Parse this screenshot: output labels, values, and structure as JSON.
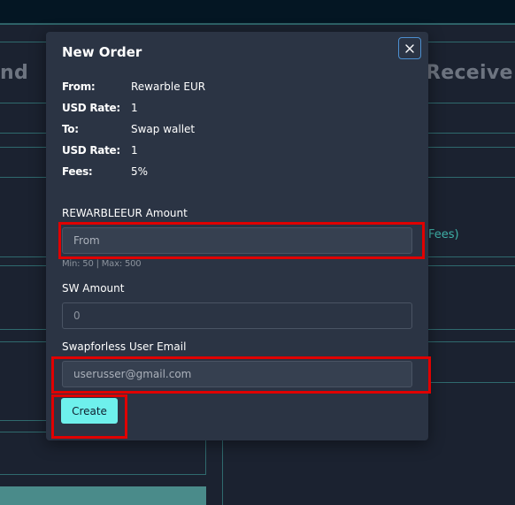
{
  "background": {
    "heading_left": "nd",
    "heading_right": "Receive",
    "fees_fragment": "Fees)"
  },
  "modal": {
    "title": "New Order",
    "close_icon": "close-icon",
    "info": [
      {
        "label": "From:",
        "value": "Rewarble EUR"
      },
      {
        "label": "USD Rate:",
        "value": "1"
      },
      {
        "label": "To:",
        "value": "Swap wallet"
      },
      {
        "label": "USD Rate:",
        "value": "1"
      },
      {
        "label": "Fees:",
        "value": "5%"
      }
    ],
    "amount_from": {
      "label": "REWARBLEEUR Amount",
      "placeholder": "From",
      "value": "",
      "hint": "Min: 50 | Max: 500"
    },
    "amount_to": {
      "label": "SW Amount",
      "placeholder": "0",
      "value": ""
    },
    "email": {
      "label": "Swapforless User Email",
      "placeholder": "userusser@gmail.com",
      "value": ""
    },
    "create_label": "Create"
  },
  "colors": {
    "accent": "#6ef0ec",
    "modal_bg": "#2b3444",
    "highlight": "#e00000",
    "teal_text": "#3fb2a9"
  }
}
